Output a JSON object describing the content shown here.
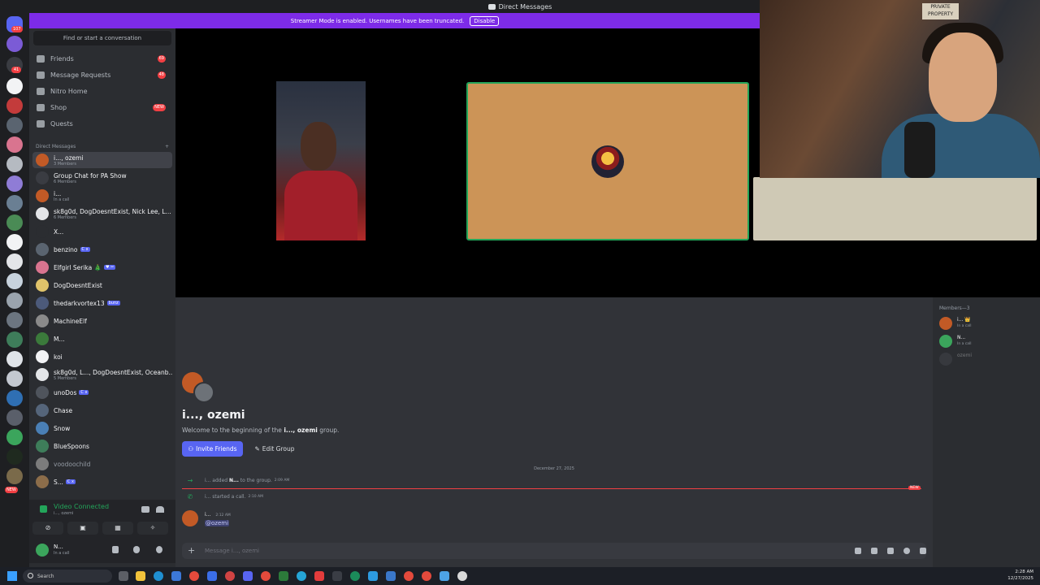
{
  "titlebar": {
    "title": "Direct Messages"
  },
  "banner": {
    "text": "Streamer Mode is enabled. Usernames have been truncated.",
    "button": "Disable"
  },
  "rail": {
    "home_badge": "107",
    "badges": [
      "41",
      "1",
      "1",
      "1",
      "1",
      "1",
      "1",
      "1",
      "1",
      "1",
      "1",
      "1",
      "1",
      "NEW"
    ]
  },
  "sidebar": {
    "search_placeholder": "Find or start a conversation",
    "nav": [
      {
        "label": "Friends",
        "badge": "69"
      },
      {
        "label": "Message Requests",
        "badge": "48"
      },
      {
        "label": "Nitro Home",
        "badge": ""
      },
      {
        "label": "Shop",
        "badge": "NEW"
      },
      {
        "label": "Quests",
        "badge": ""
      }
    ],
    "dm_header": "Direct Messages",
    "dm_add": "+",
    "dms": [
      {
        "name": "i..., ozemi",
        "sub": "3 Members",
        "color": "#c25a26"
      },
      {
        "name": "Group Chat for PA Show",
        "sub": "6 Members",
        "color": "#3a3c42"
      },
      {
        "name": "i...",
        "sub": "In a call",
        "color": "#c25a26"
      },
      {
        "name": "sk8g0d, DogDoesntExist, Nick Lee, L...",
        "sub": "6 Members",
        "color": "#e3e5e8"
      },
      {
        "name": "X...",
        "sub": "",
        "color": "#2b2d31"
      },
      {
        "name": "benzino",
        "sub": "",
        "color": "#5a6470",
        "tag": "C x"
      },
      {
        "name": "Elfgirl Serika 🎄",
        "sub": "",
        "color": "#d9748f",
        "tag": "♥ ✂"
      },
      {
        "name": "DogDoesntExist",
        "sub": "",
        "color": "#e0c36a"
      },
      {
        "name": "thedarkvortex13",
        "sub": "",
        "color": "#4c5a7a",
        "tag": "bunz"
      },
      {
        "name": "MachineElf",
        "sub": "",
        "color": "#8a8a8a"
      },
      {
        "name": "M...",
        "sub": "",
        "color": "#3b7a3b"
      },
      {
        "name": "koi",
        "sub": "",
        "color": "#f2f3f5"
      },
      {
        "name": "sk8g0d, L..., DogDoesntExist, Oceanb...",
        "sub": "5 Members",
        "color": "#e3e5e8"
      },
      {
        "name": "unoDos",
        "sub": "",
        "color": "#4f545c",
        "tag": "C x"
      },
      {
        "name": "Chase",
        "sub": "",
        "color": "#55657a"
      },
      {
        "name": "Snow",
        "sub": "",
        "color": "#4a7fb5"
      },
      {
        "name": "BlueSpoons",
        "sub": "",
        "color": "#3e7d5a"
      },
      {
        "name": "voodoochild",
        "sub": "",
        "color": "#7c7c7c",
        "dim": true
      },
      {
        "name": "S...",
        "sub": "",
        "color": "#8c6d4a",
        "tag": "C x"
      }
    ]
  },
  "voice": {
    "status": "Video Connected",
    "channel": "i..., ozemi"
  },
  "user": {
    "name": "N...",
    "status": "In a call"
  },
  "chat": {
    "group_title": "i..., ozemi",
    "welcome_prefix": "Welcome to the beginning of the ",
    "welcome_name": "i..., ozemi",
    "welcome_suffix": " group.",
    "invite_label": "Invite Friends",
    "edit_label": "Edit Group",
    "date": "December 27, 2025",
    "sys1": {
      "actor": "i...",
      "mid": " added ",
      "target": "N...",
      "end": " to the group.",
      "time": "2:09 AM"
    },
    "sys2": {
      "actor": "i...",
      "mid": " started a call.",
      "time": "2:10 AM"
    },
    "new_tag": "NEW",
    "msg": {
      "author": "i...",
      "time": "2:12 AM",
      "text": "@ozemi"
    },
    "placeholder": "Message i..., ozemi"
  },
  "members": {
    "header": "Members—3",
    "list": [
      {
        "name": "i... 👑",
        "status": "In a call",
        "color": "#c25a26"
      },
      {
        "name": "N...",
        "status": "In a call",
        "color": "#3ba55c"
      },
      {
        "name": "ozemi",
        "status": "",
        "color": "#4e5058"
      }
    ]
  },
  "webcam": {
    "sign_text": "PRIVATE PROPERTY"
  },
  "taskbar": {
    "search_label": "Search",
    "time": "2:28 AM",
    "date": "12/27/2025"
  }
}
